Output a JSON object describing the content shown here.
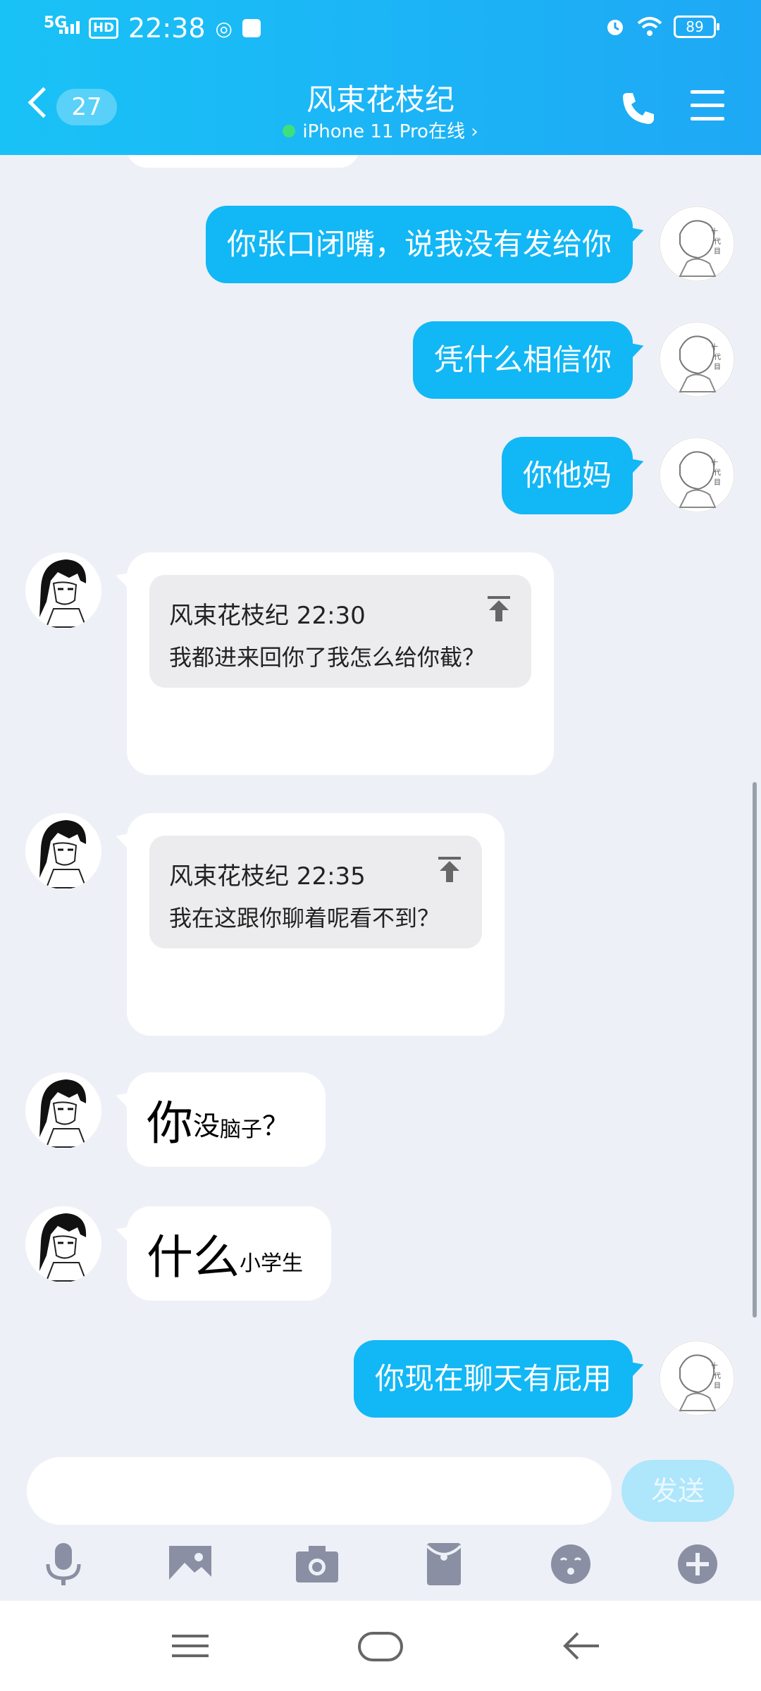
{
  "status_bar": {
    "network": "5G",
    "hd": "HD",
    "time": "22:38",
    "battery": "89"
  },
  "header": {
    "unread_count": "27",
    "title": "风束花枝纪",
    "device_status": "iPhone 11 Pro在线",
    "device_chevron": "›"
  },
  "messages": [
    {
      "from": "me",
      "text": "你张口闭嘴，说我没有发给你"
    },
    {
      "from": "me",
      "text": "凭什么相信你"
    },
    {
      "from": "me",
      "text": "你他妈"
    },
    {
      "from": "other",
      "quote_header": "风束花枝纪 22:30",
      "quote_text": "我都进来回你了我怎么给你截？"
    },
    {
      "from": "other",
      "quote_header": "风束花枝纪 22:35",
      "quote_text": "我在这跟你聊着呢看不到？"
    },
    {
      "from": "other",
      "parts": [
        "你",
        "没",
        "脑子",
        "？"
      ]
    },
    {
      "from": "other",
      "parts": [
        "什么",
        "小学生"
      ]
    },
    {
      "from": "me",
      "text": "你现在聊天有屁用"
    }
  ],
  "input": {
    "placeholder": "",
    "send_label": "发送"
  },
  "toolbar_icons": [
    "mic-icon",
    "image-icon",
    "camera-icon",
    "red-packet-icon",
    "emoji-icon",
    "plus-icon"
  ],
  "colors": {
    "header_gradient_start": "#19c2f6",
    "header_gradient_end": "#1ea8f5",
    "outgoing_bubble": "#12b7f5",
    "incoming_bubble": "#ffffff",
    "chat_background": "#eef0f7",
    "send_button": "#aee6fb",
    "online_dot": "#3ee07b",
    "icon_gray": "#8a8fa3"
  }
}
